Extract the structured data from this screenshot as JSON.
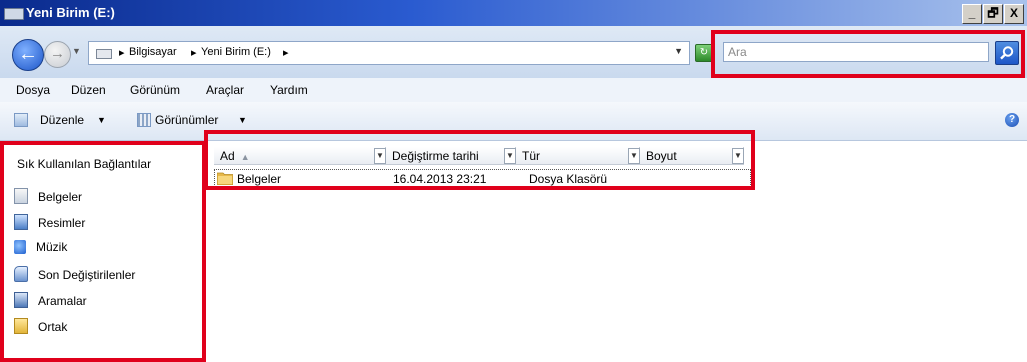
{
  "window": {
    "title": "Yeni Birim (E:)",
    "controls": {
      "minimize": "_",
      "maximize": "🗗",
      "close": "X"
    }
  },
  "navigation": {
    "breadcrumb": [
      "Bilgisayar",
      "Yeni Birim (E:)"
    ],
    "search_placeholder": "Ara"
  },
  "menubar": {
    "items": [
      "Dosya",
      "Düzen",
      "Görünüm",
      "Araçlar",
      "Yardım"
    ]
  },
  "toolbar": {
    "organize_label": "Düzenle",
    "views_label": "Görünümler"
  },
  "sidebar": {
    "title": "Sık Kullanılan Bağlantılar",
    "items": [
      "Belgeler",
      "Resimler",
      "Müzik",
      "Son Değiştirilenler",
      "Aramalar",
      "Ortak"
    ]
  },
  "file_list": {
    "columns": [
      "Ad",
      "Değiştirme tarihi",
      "Tür",
      "Boyut"
    ],
    "rows": [
      {
        "name": "Belgeler",
        "modified": "16.04.2013 23:21",
        "type": "Dosya Klasörü",
        "size": ""
      }
    ]
  },
  "colors": {
    "highlight": "#e0001b"
  }
}
